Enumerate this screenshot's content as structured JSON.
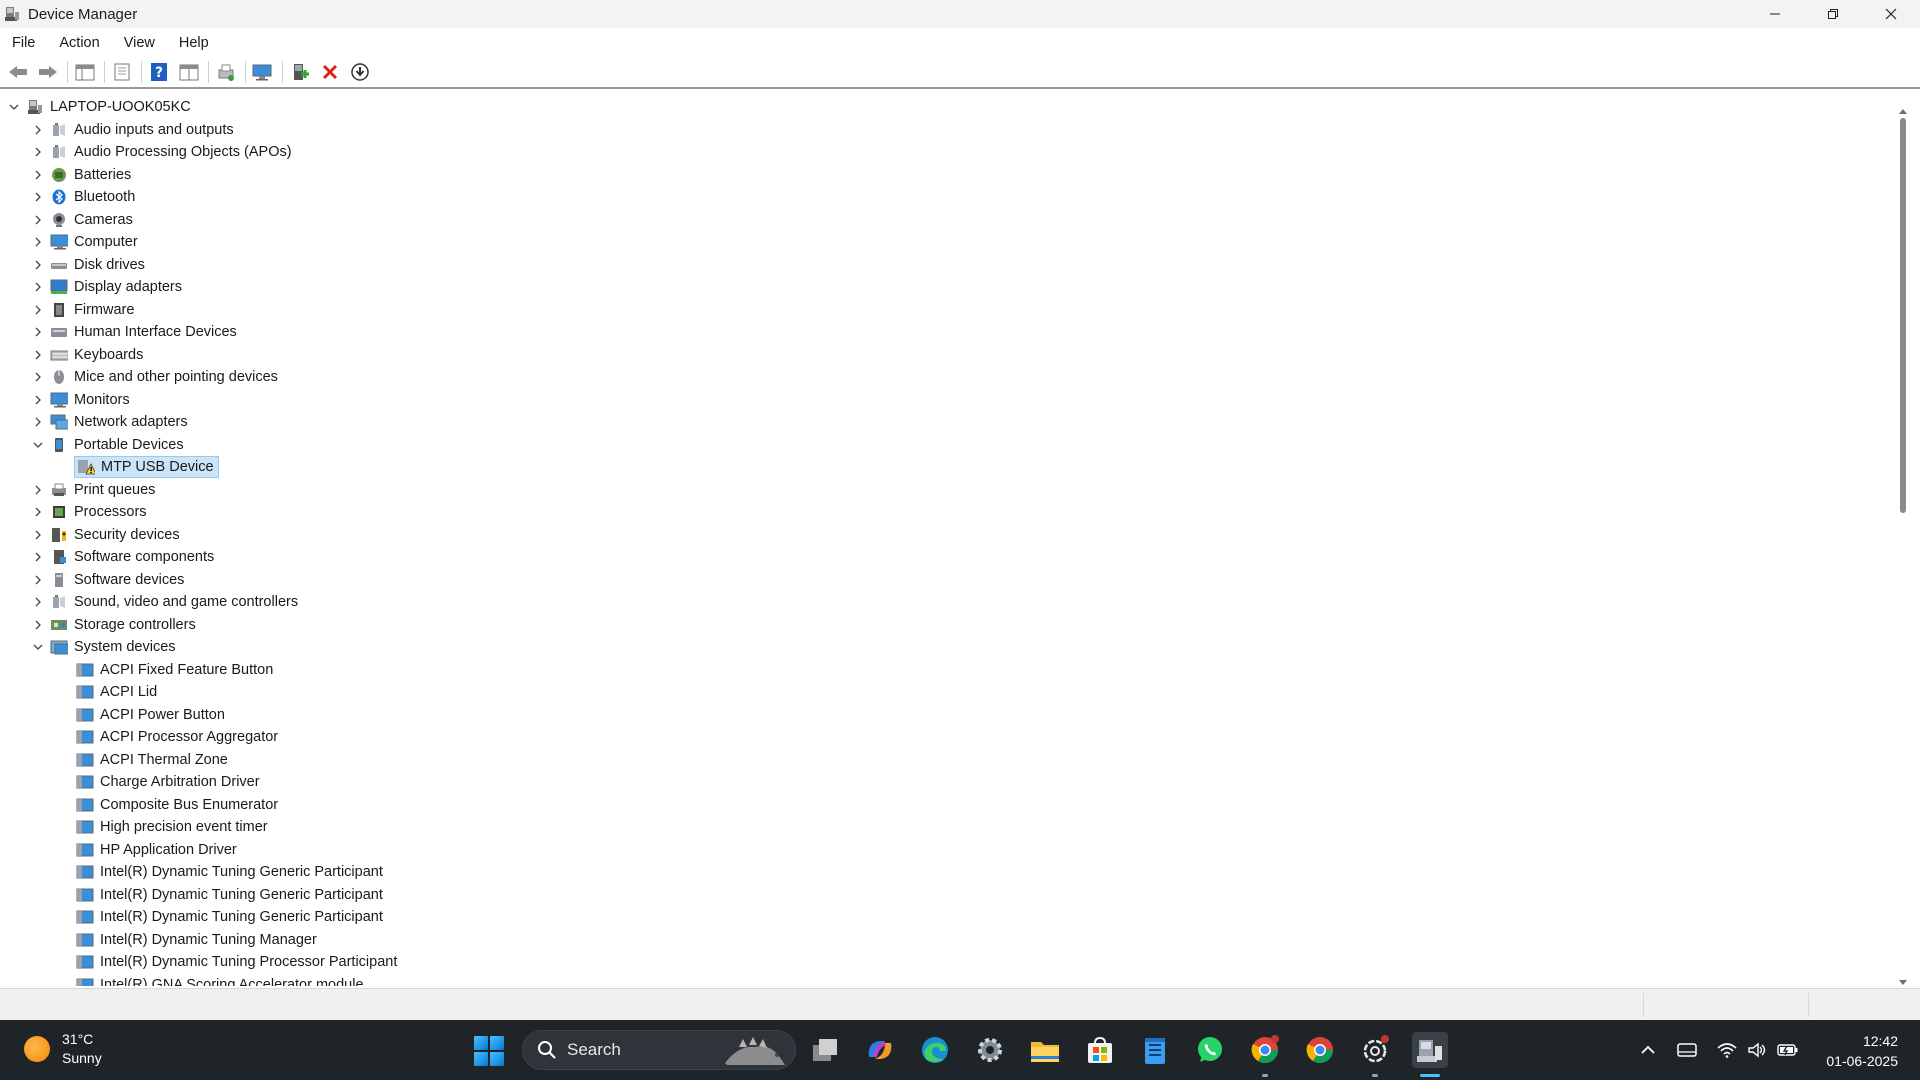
{
  "window": {
    "title": "Device Manager"
  },
  "menu": {
    "file": "File",
    "action": "Action",
    "view": "View",
    "help": "Help"
  },
  "toolbar": {
    "buttons": [
      "back-icon",
      "forward-icon",
      "properties-icon",
      "update-icon",
      "help-icon",
      "view-icon",
      "print-icon",
      "monitor-icon",
      "add-driver-icon",
      "remove-icon",
      "download-icon"
    ]
  },
  "tree": {
    "root": "LAPTOP-UOOK05KC",
    "categories": [
      "Audio inputs and outputs",
      "Audio Processing Objects (APOs)",
      "Batteries",
      "Bluetooth",
      "Cameras",
      "Computer",
      "Disk drives",
      "Display adapters",
      "Firmware",
      "Human Interface Devices",
      "Keyboards",
      "Mice and other pointing devices",
      "Monitors",
      "Network adapters",
      "Portable Devices",
      "Print queues",
      "Processors",
      "Security devices",
      "Software components",
      "Software devices",
      "Sound, video and game controllers",
      "Storage controllers",
      "System devices"
    ],
    "portable_children": [
      "MTP USB Device"
    ],
    "system_children": [
      "ACPI Fixed Feature Button",
      "ACPI Lid",
      "ACPI Power Button",
      "ACPI Processor Aggregator",
      "ACPI Thermal Zone",
      "Charge Arbitration Driver",
      "Composite Bus Enumerator",
      "High precision event timer",
      "HP Application Driver",
      "Intel(R) Dynamic Tuning Generic Participant",
      "Intel(R) Dynamic Tuning Generic Participant",
      "Intel(R) Dynamic Tuning Generic Participant",
      "Intel(R) Dynamic Tuning Manager",
      "Intel(R) Dynamic Tuning Processor Participant",
      "Intel(R) GNA Scoring Accelerator module"
    ]
  },
  "taskbar": {
    "weather_temp": "31°C",
    "weather_desc": "Sunny",
    "search_label": "Search",
    "time": "12:42",
    "date": "01-06-2025"
  }
}
